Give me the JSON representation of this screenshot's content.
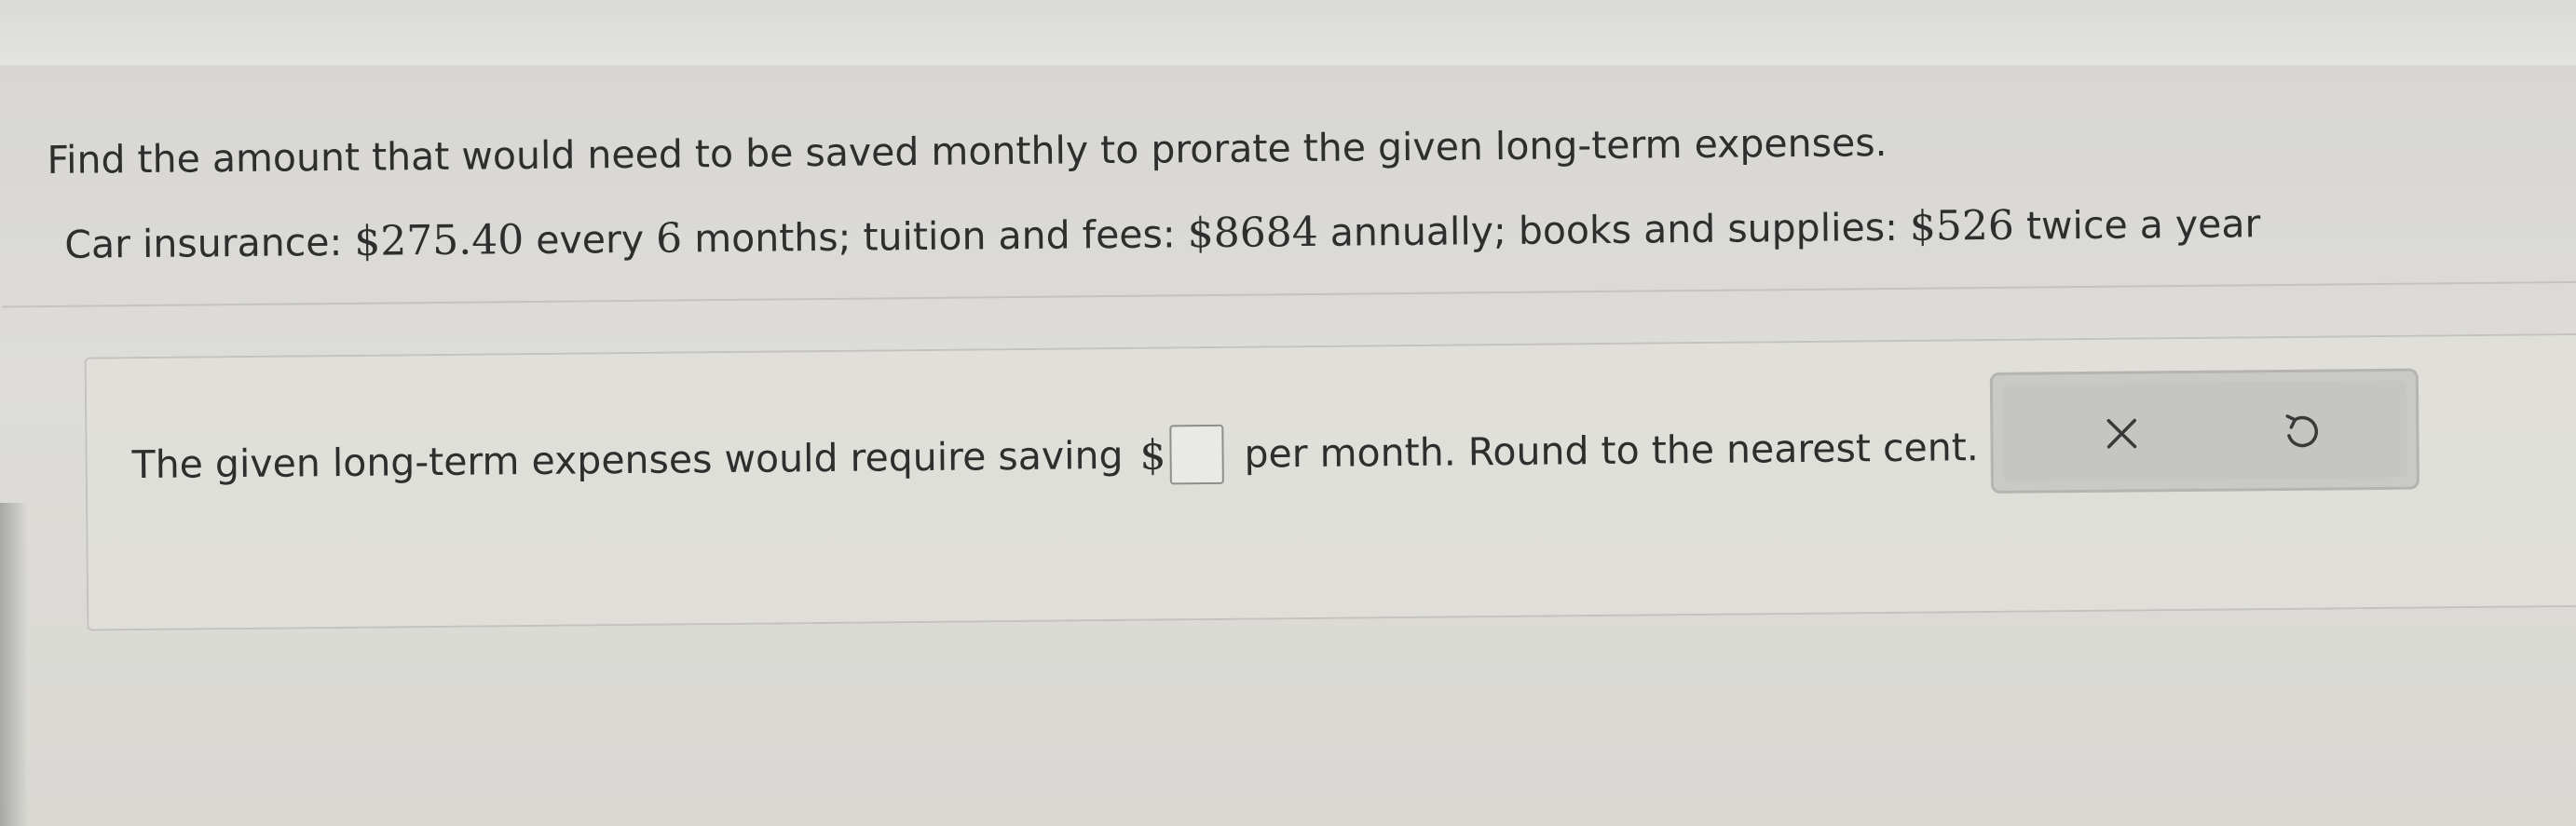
{
  "question": {
    "prompt": "Find the amount that would need to be saved monthly to prorate the given long-term expenses.",
    "given": {
      "car_insurance_label": "Car insurance: ",
      "car_insurance_amount": "$275.40",
      "car_insurance_mid": " every ",
      "car_insurance_period": "6",
      "car_insurance_end": " months; tuition and fees: ",
      "tuition_amount": "$8684",
      "tuition_end": " annually; books and supplies: ",
      "books_amount": "$526",
      "books_end": " twice a year"
    }
  },
  "answer": {
    "prefix": "The given long-term expenses would require saving",
    "currency": "$",
    "value": "",
    "suffix": "per month. Round to the nearest cent."
  },
  "actions": {
    "clear_icon": "close-icon",
    "undo_icon": "undo-icon"
  }
}
